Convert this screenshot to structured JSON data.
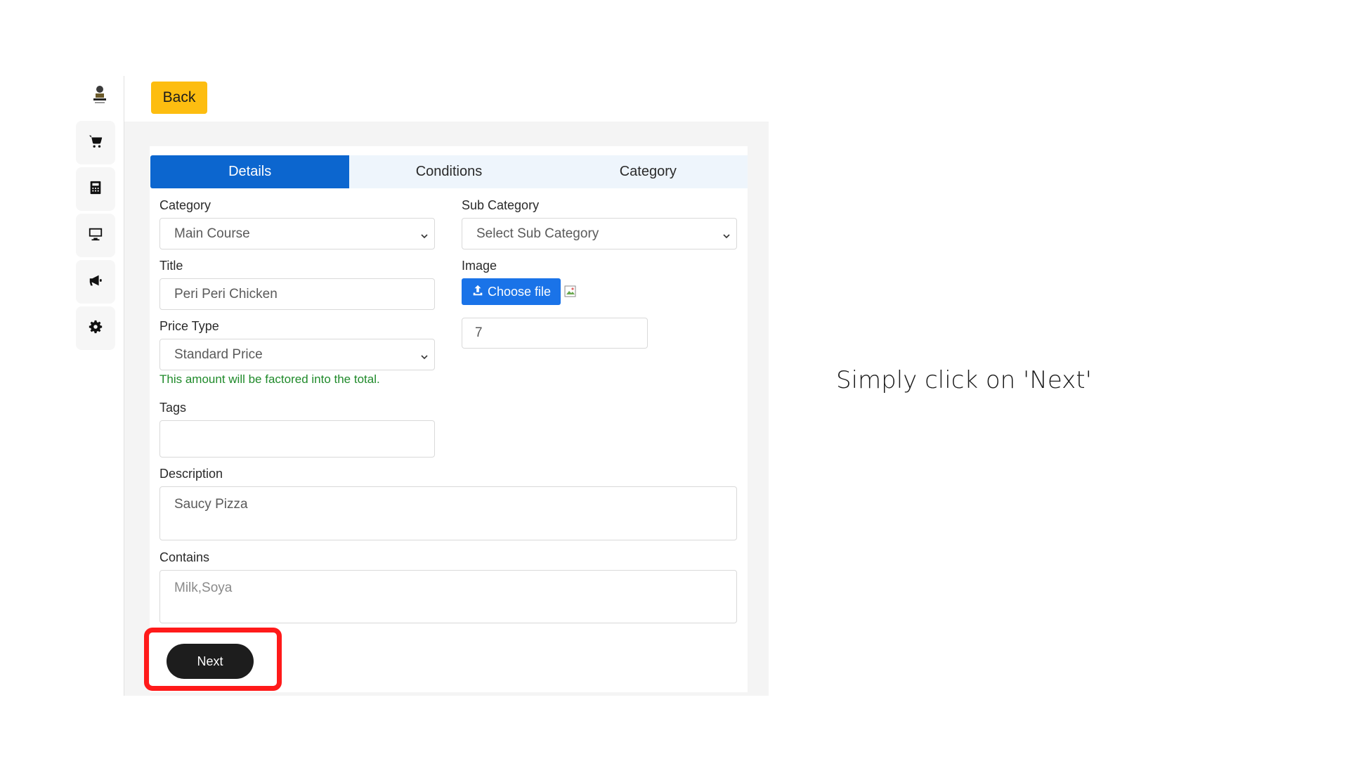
{
  "header": {
    "back_label": "Back"
  },
  "sidebar": {
    "items": [
      {
        "icon": "cart-icon"
      },
      {
        "icon": "calculator-icon"
      },
      {
        "icon": "monitor-icon"
      },
      {
        "icon": "megaphone-icon"
      },
      {
        "icon": "gear-icon"
      }
    ]
  },
  "tabs": {
    "details": "Details",
    "conditions": "Conditions",
    "category": "Category"
  },
  "form": {
    "category_label": "Category",
    "category_value": "Main Course",
    "sub_category_label": "Sub Category",
    "sub_category_value": "Select Sub Category",
    "title_label": "Title",
    "title_value": "Peri Peri Chicken",
    "image_label": "Image",
    "choose_file_label": "Choose file",
    "number_value": "7",
    "price_type_label": "Price Type",
    "price_type_value": "Standard Price",
    "price_hint": "This amount will be factored into the total.",
    "tags_label": "Tags",
    "tags_value": "",
    "description_label": "Description",
    "description_value": "Saucy Pizza",
    "contains_label": "Contains",
    "contains_value": "Milk,Soya",
    "next_label": "Next"
  },
  "instruction": "Simply click on 'Next'",
  "colors": {
    "accent_blue": "#0c66cf",
    "back_yellow": "#fdbd10",
    "hint_green": "#1f8a2a",
    "highlight_red": "#ff1a1a",
    "next_dark": "#1d1d1d"
  }
}
